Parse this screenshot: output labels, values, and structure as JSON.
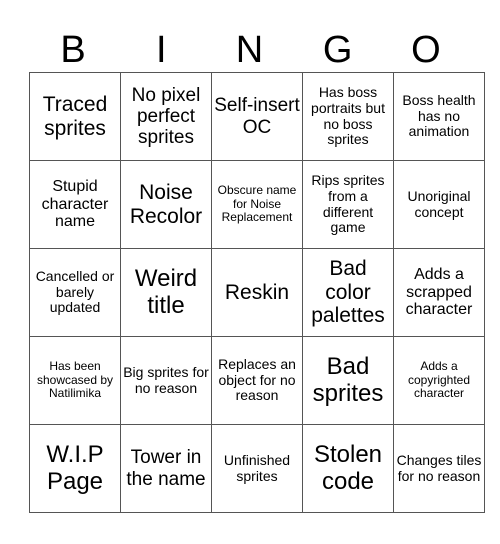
{
  "header": [
    "B",
    "I",
    "N",
    "G",
    "O"
  ],
  "rows": [
    [
      "Traced sprites",
      "No pixel perfect sprites",
      "Self-insert OC",
      "Has boss portraits but no boss sprites",
      "Boss health has no animation"
    ],
    [
      "Stupid character name",
      "Noise Recolor",
      "Obscure name for Noise Replacement",
      "Rips sprites from a different game",
      "Unoriginal concept"
    ],
    [
      "Cancelled or barely updated",
      "Weird title",
      "Reskin",
      "Bad color palettes",
      "Adds a scrapped character"
    ],
    [
      "Has been showcased by Natilimika",
      "Big sprites for no reason",
      "Replaces an object for no reason",
      "Bad sprites",
      "Adds a copyrighted character"
    ],
    [
      "W.I.P Page",
      "Tower in the name",
      "Unfinished sprites",
      "Stolen code",
      "Changes tiles for no reason"
    ]
  ]
}
